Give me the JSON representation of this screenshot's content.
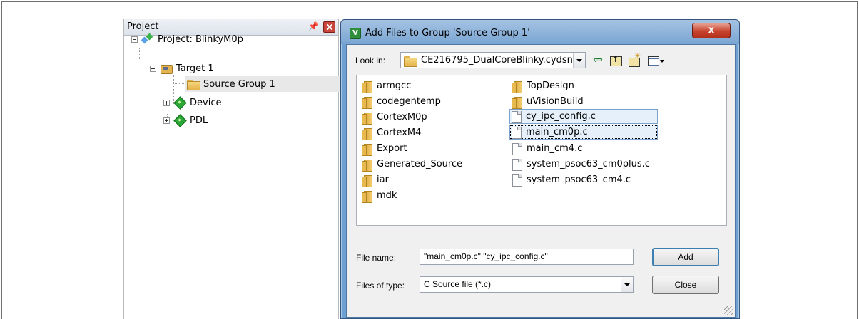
{
  "project_panel": {
    "title": "Project",
    "pin_glyph": "\u0004",
    "tree": {
      "project": "Project: BlinkyM0p",
      "target": "Target 1",
      "source_group": "Source Group 1",
      "device": "Device",
      "pdl": "PDL"
    }
  },
  "dialog": {
    "title": "Add Files to Group 'Source Group 1'",
    "close_glyph": "x",
    "look_in_label": "Look in:",
    "look_in_value": "CE216795_DualCoreBlinky.cydsn",
    "folders_col1": [
      "armgcc",
      "codegentemp",
      "CortexM0p",
      "CortexM4",
      "Export",
      "Generated_Source",
      "iar",
      "mdk"
    ],
    "col2": {
      "folders": [
        "TopDesign",
        "uVisionBuild"
      ],
      "files": [
        "cy_ipc_config.c",
        "main_cm0p.c",
        "main_cm4.c",
        "system_psoc63_cm0plus.c",
        "system_psoc63_cm4.c"
      ]
    },
    "file_name_label": "File name:",
    "file_name_value": "\"main_cm0p.c\" \"cy_ipc_config.c\"",
    "files_of_type_label": "Files of type:",
    "files_of_type_value": "C Source file (*.c)",
    "add_label": "Add",
    "close_label": "Close"
  },
  "icons": {
    "back": "back-arrow-icon",
    "up": "up-folder-icon",
    "new": "new-folder-icon",
    "view": "view-menu-icon"
  }
}
